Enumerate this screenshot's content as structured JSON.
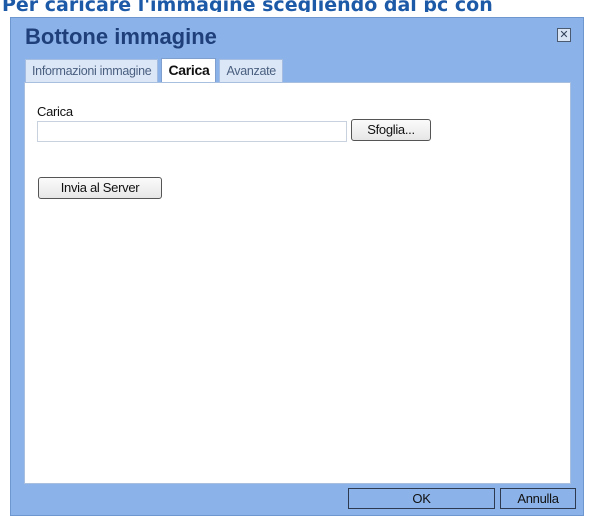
{
  "caption": {
    "text": "Per caricare l'immagine scegliendo dal pc con"
  },
  "dialog": {
    "title": "Bottone immagine",
    "close_icon": "close-icon",
    "tabs": [
      {
        "label": "Informazioni immagine",
        "active": false
      },
      {
        "label": "Carica",
        "active": true
      },
      {
        "label": "Avanzate",
        "active": false
      }
    ],
    "upload": {
      "label": "Carica",
      "file_value": "",
      "browse_label": "Sfoglia...",
      "send_label": "Invia al Server"
    },
    "footer": {
      "ok_label": "OK",
      "cancel_label": "Annulla"
    }
  },
  "colors": {
    "dialog_bg": "#8cb3e9",
    "title": "#1f3f7a",
    "caption": "#1c5aa8"
  }
}
